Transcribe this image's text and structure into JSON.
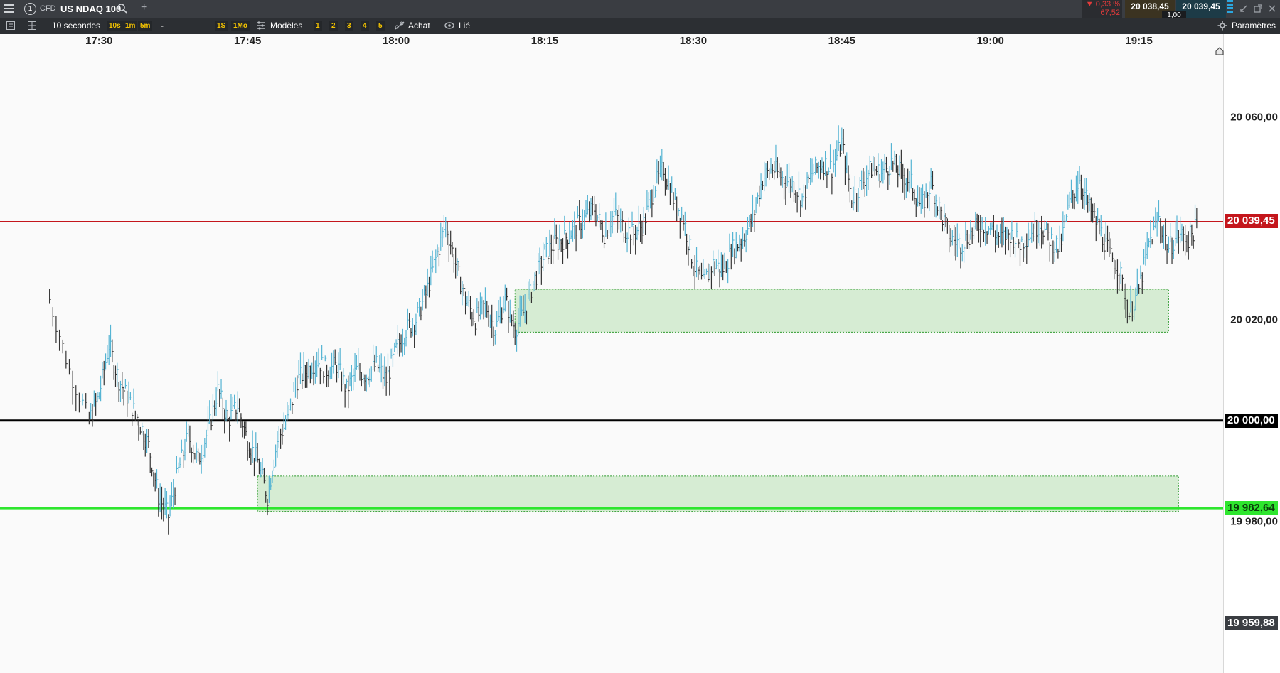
{
  "header": {
    "window_index": "1",
    "instrument_type": "CFD",
    "instrument_name": "US NDAQ 100",
    "add_tab": "+",
    "change_pct": "▼ 0,33 %",
    "change_abs": "67,52",
    "sell_price": "20 038,45",
    "buy_price": "20 039,45",
    "spread": "1,00"
  },
  "toolbar": {
    "interval_label": "10 secondes",
    "quick_intervals": [
      "10s",
      "1m",
      "5m"
    ],
    "separator": "-",
    "periods": [
      "1S",
      "1Mo"
    ],
    "templates_label": "Modèles",
    "slots": [
      "1",
      "2",
      "3",
      "4",
      "5"
    ],
    "buy_label": "Achat",
    "linked_label": "Lié",
    "settings_label": "Paramètres"
  },
  "colors": {
    "candle_up": "#55b4d3",
    "candle_down": "#333333",
    "current_price": "#c4161c",
    "support_line": "#2ee62e",
    "zone_fill": "#d6ecd3",
    "zone_border": "#2e9a2e"
  },
  "chart_data": {
    "type": "line",
    "x_tick_labels": [
      "17:30",
      "17:45",
      "18:00",
      "18:15",
      "18:30",
      "18:45",
      "19:00",
      "19:15"
    ],
    "y_tick_labels": [
      "20 060,00",
      "20 020,00",
      "19 980,00"
    ],
    "ylim": [
      19950,
      20074
    ],
    "xlim_minutes": [
      1040,
      1163.5
    ],
    "grid": false,
    "current_price": {
      "value": 20039.45,
      "label": "20 039,45"
    },
    "level_lines": [
      {
        "value": 20000.0,
        "label": "20 000,00",
        "color": "#000000"
      },
      {
        "value": 19982.64,
        "label": "19 982,64",
        "color": "#2ee62e"
      }
    ],
    "bottom_label": {
      "value": 19959.88,
      "label": "19 959,88"
    },
    "zones": [
      {
        "time_start": "18:12",
        "time_end": "19:18",
        "price_low": 20017.5,
        "price_high": 20026.0
      },
      {
        "time_start": "17:46",
        "time_end": "19:19",
        "price_low": 19982.0,
        "price_high": 19989.0
      }
    ],
    "series": [
      {
        "values": [
          [
            "17:25",
            20024
          ],
          [
            "17:27",
            20010
          ],
          [
            "17:29",
            20000
          ],
          [
            "17:30",
            20005
          ],
          [
            "17:31",
            20015
          ],
          [
            "17:32",
            20008
          ],
          [
            "17:33",
            20004
          ],
          [
            "17:34",
            20000
          ],
          [
            "17:35",
            19995
          ],
          [
            "17:36",
            19985
          ],
          [
            "17:37",
            19981
          ],
          [
            "17:38",
            19990
          ],
          [
            "17:39",
            19997
          ],
          [
            "17:40",
            19992
          ],
          [
            "17:41",
            19998
          ],
          [
            "17:42",
            20006
          ],
          [
            "17:43",
            20000
          ],
          [
            "17:44",
            20003
          ],
          [
            "17:45",
            19996
          ],
          [
            "17:46",
            19992
          ],
          [
            "17:47",
            19985
          ],
          [
            "17:48",
            19996
          ],
          [
            "17:49",
            20000
          ],
          [
            "17:50",
            20008
          ],
          [
            "17:51",
            20010
          ],
          [
            "17:52",
            20012
          ],
          [
            "17:53",
            20010
          ],
          [
            "17:54",
            20011
          ],
          [
            "17:55",
            20006
          ],
          [
            "17:56",
            20010
          ],
          [
            "17:57",
            20009
          ],
          [
            "17:58",
            20011
          ],
          [
            "17:59",
            20008
          ],
          [
            "18:00",
            20014
          ],
          [
            "18:01",
            20018
          ],
          [
            "18:02",
            20020
          ],
          [
            "18:03",
            20025
          ],
          [
            "18:04",
            20032
          ],
          [
            "18:05",
            20039
          ],
          [
            "18:06",
            20031
          ],
          [
            "18:07",
            20024
          ],
          [
            "18:08",
            20020
          ],
          [
            "18:09",
            20023
          ],
          [
            "18:10",
            20018
          ],
          [
            "18:11",
            20024
          ],
          [
            "18:12",
            20018
          ],
          [
            "18:13",
            20022
          ],
          [
            "18:14",
            20028
          ],
          [
            "18:15",
            20033
          ],
          [
            "18:16",
            20035
          ],
          [
            "18:17",
            20036
          ],
          [
            "18:18",
            20038
          ],
          [
            "18:19",
            20040
          ],
          [
            "18:20",
            20042
          ],
          [
            "18:21",
            20037
          ],
          [
            "18:22",
            20041
          ],
          [
            "18:23",
            20038
          ],
          [
            "18:24",
            20037
          ],
          [
            "18:25",
            20039
          ],
          [
            "18:26",
            20046
          ],
          [
            "18:27",
            20050
          ],
          [
            "18:28",
            20044
          ],
          [
            "18:29",
            20040
          ],
          [
            "18:30",
            20031
          ],
          [
            "18:31",
            20027
          ],
          [
            "18:32",
            20031
          ],
          [
            "18:33",
            20030
          ],
          [
            "18:34",
            20034
          ],
          [
            "18:35",
            20036
          ],
          [
            "18:36",
            20040
          ],
          [
            "18:37",
            20048
          ],
          [
            "18:38",
            20050
          ],
          [
            "18:39",
            20048
          ],
          [
            "18:40",
            20047
          ],
          [
            "18:41",
            20044
          ],
          [
            "18:42",
            20049
          ],
          [
            "18:43",
            20051
          ],
          [
            "18:44",
            20050
          ],
          [
            "18:45",
            20055
          ],
          [
            "18:46",
            20044
          ],
          [
            "18:47",
            20047
          ],
          [
            "18:48",
            20050
          ],
          [
            "18:49",
            20049
          ],
          [
            "18:50",
            20051
          ],
          [
            "18:51",
            20049
          ],
          [
            "18:52",
            20047
          ],
          [
            "18:53",
            20042
          ],
          [
            "18:54",
            20047
          ],
          [
            "18:55",
            20041
          ],
          [
            "18:56",
            20036
          ],
          [
            "18:57",
            20035
          ],
          [
            "18:58",
            20037
          ],
          [
            "18:59",
            20039
          ],
          [
            "19:00",
            20038
          ],
          [
            "19:01",
            20036
          ],
          [
            "19:02",
            20037
          ],
          [
            "19:03",
            20035
          ],
          [
            "19:04",
            20037
          ],
          [
            "19:05",
            20039
          ],
          [
            "19:06",
            20036
          ],
          [
            "19:07",
            20034
          ],
          [
            "19:08",
            20043
          ],
          [
            "19:09",
            20048
          ],
          [
            "19:10",
            20042
          ],
          [
            "19:11",
            20038
          ],
          [
            "19:12",
            20033
          ],
          [
            "19:13",
            20030
          ],
          [
            "19:14",
            20021
          ],
          [
            "19:15",
            20026
          ],
          [
            "19:16",
            20035
          ],
          [
            "19:17",
            20040
          ],
          [
            "19:18",
            20034
          ],
          [
            "19:19",
            20037
          ],
          [
            "19:20",
            20036
          ],
          [
            "19:21",
            20039
          ]
        ]
      }
    ]
  }
}
